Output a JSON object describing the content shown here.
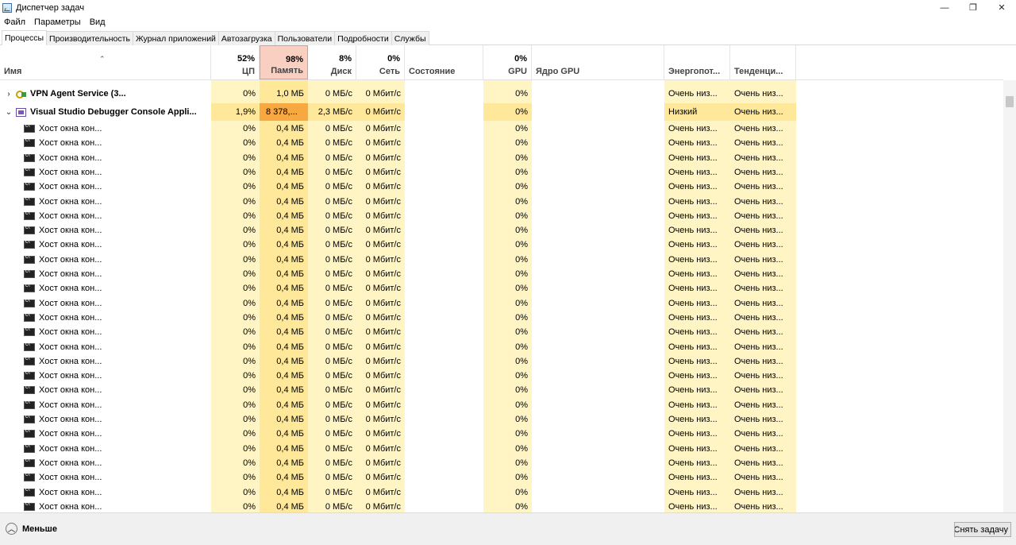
{
  "window": {
    "title": "Диспетчер задач",
    "controls": [
      "—",
      "❐",
      "✕"
    ]
  },
  "menu": [
    "Файл",
    "Параметры",
    "Вид"
  ],
  "tabs": [
    {
      "label": "Процессы",
      "active": true
    },
    {
      "label": "Производительность",
      "active": false
    },
    {
      "label": "Журнал приложений",
      "active": false
    },
    {
      "label": "Автозагрузка",
      "active": false
    },
    {
      "label": "Пользователи",
      "active": false
    },
    {
      "label": "Подробности",
      "active": false
    },
    {
      "label": "Службы",
      "active": false
    }
  ],
  "columns": {
    "name": {
      "label": "Имя"
    },
    "cpu": {
      "label": "ЦП",
      "total": "52%"
    },
    "mem": {
      "label": "Память",
      "total": "98%"
    },
    "disk": {
      "label": "Диск",
      "total": "8%"
    },
    "net": {
      "label": "Сеть",
      "total": "0%"
    },
    "status": {
      "label": "Состояние"
    },
    "gpu": {
      "label": "GPU",
      "total": "0%"
    },
    "gpu_engine": {
      "label": "Ядро GPU"
    },
    "power": {
      "label": "Энергопот..."
    },
    "trend": {
      "label": "Тенденци..."
    }
  },
  "processes": [
    {
      "name": "VPN Agent Service (3...",
      "icon": "vpn-icon",
      "expand": "›",
      "top": true,
      "cpu": "0%",
      "mem": "1,0 МБ",
      "disk": "0 МБ/с",
      "net": "0 Мбит/с",
      "status": "",
      "gpu": "0%",
      "gpu_engine": "",
      "power": "Очень низ...",
      "trend": "Очень низ..."
    },
    {
      "name": "Visual Studio Debugger Console Appli...",
      "icon": "vs-console-icon",
      "expand": "⌄",
      "top": true,
      "hot": true,
      "cpu": "1,9%",
      "mem": "8 378,...",
      "disk": "2,3 МБ/с",
      "net": "0 Мбит/с",
      "status": "",
      "gpu": "0%",
      "gpu_engine": "",
      "power": "Низкий",
      "trend": "Очень низ..."
    }
  ],
  "child": {
    "name": "Хост окна кон...",
    "icon": "console-host-icon",
    "cpu": "0%",
    "mem": "0,4 МБ",
    "disk": "0 МБ/с",
    "net": "0 Мбит/с",
    "status": "",
    "gpu": "0%",
    "gpu_engine": "",
    "power": "Очень низ...",
    "trend": "Очень низ..."
  },
  "child_count": 27,
  "footer": {
    "fewer_label": "Меньше",
    "end_task_label": "Снять задачу"
  }
}
